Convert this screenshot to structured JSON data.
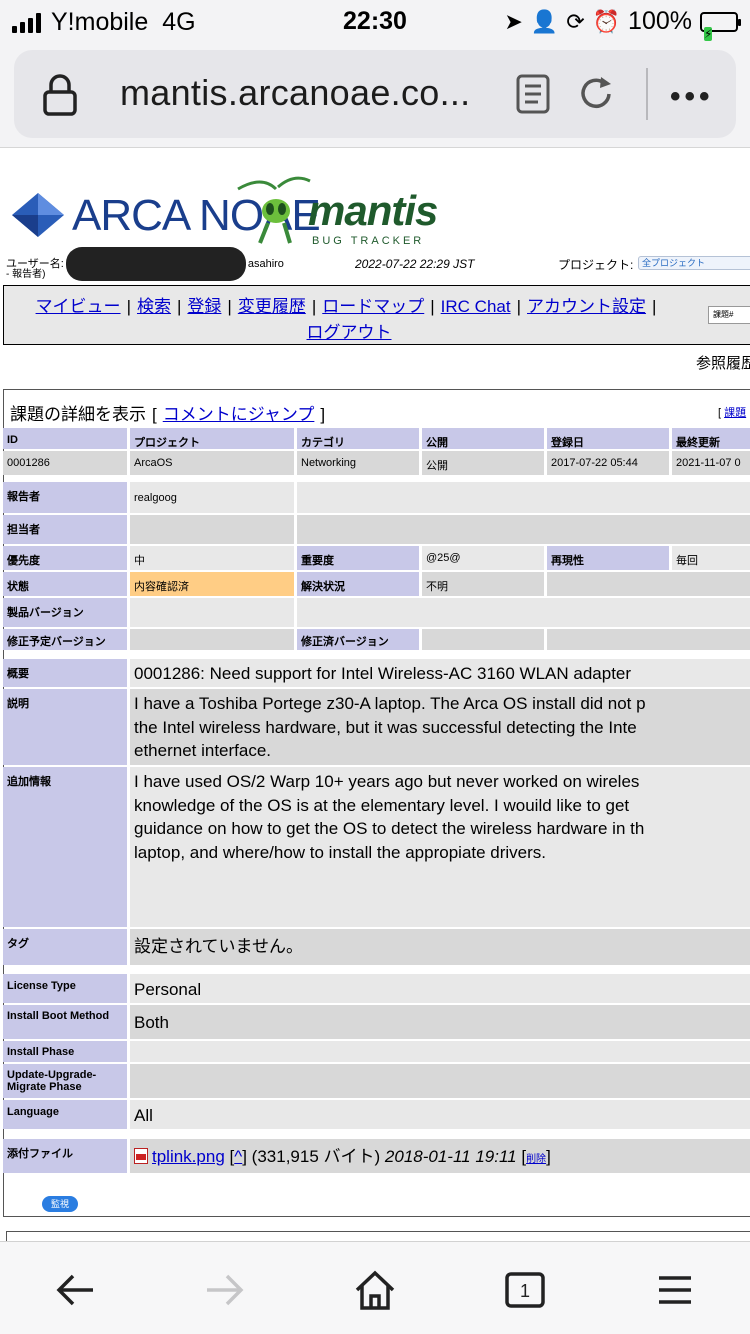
{
  "status": {
    "carrier": "Y!mobile",
    "network": "4G",
    "time": "22:30",
    "battery": "100%"
  },
  "browser": {
    "url": "mantis.arcanoae.co..."
  },
  "header": {
    "arca_logo_text": "ARCA NOAE",
    "mantis_logo_text": "mantis",
    "mantis_logo_sub": "BUG TRACKER",
    "username_label": "ユーザー名:",
    "username_suffix": "asahiro",
    "reporter_sub": "- 報告者)",
    "timestamp": "2022-07-22 22:29 JST",
    "project_label": "プロジェクト:",
    "project_value": "全プロジェクト"
  },
  "menu": {
    "items": [
      "マイビュー",
      "検索",
      "登録",
      "変更履歴",
      "ロードマップ",
      "IRC Chat",
      "アカウント設定"
    ],
    "logout": "ログアウト",
    "search_placeholder": "課題#"
  },
  "history_link": "参照履歴",
  "issue": {
    "title": "課題の詳細を表示",
    "jump_link": "コメントにジャンプ",
    "right_link": "課題",
    "columns": [
      "ID",
      "プロジェクト",
      "カテゴリ",
      "公開",
      "登録日",
      "最終更新"
    ],
    "values": [
      "0001286",
      "ArcaOS",
      "Networking",
      "公開",
      "2017-07-22 05:44",
      "2021-11-07 0"
    ],
    "reporter_label": "報告者",
    "reporter": "realgoog",
    "handler_label": "担当者",
    "priority_label": "優先度",
    "priority": "中",
    "severity_label": "重要度",
    "severity": "@25@",
    "reproducibility_label": "再現性",
    "reproducibility": "毎回",
    "status_label": "状態",
    "status": "内容確認済",
    "resolution_label": "解決状況",
    "resolution": "不明",
    "product_version_label": "製品バージョン",
    "target_version_label": "修正予定バージョン",
    "fixed_version_label": "修正済バージョン",
    "summary_label": "概要",
    "summary": "0001286: Need support for Intel Wireless-AC 3160 WLAN adapter",
    "description_label": "説明",
    "description": [
      "I have a Toshiba Portege z30-A laptop. The Arca OS install did not p",
      "the Intel wireless hardware, but it was successful detecting the Inte",
      "ethernet interface."
    ],
    "additional_label": "追加情報",
    "additional": [
      "I have used OS/2 Warp 10+ years ago but never worked on wireles",
      "knowledge of the OS is at the elementary level. I wouild like to get",
      "guidance on how to get the OS to detect the wireless hardware in th",
      "laptop, and where/how to install the appropiate drivers."
    ],
    "tags_label": "タグ",
    "tags": "設定されていません。",
    "license_label": "License Type",
    "license": "Personal",
    "boot_label": "Install Boot Method",
    "boot": "Both",
    "phase_label": "Install Phase",
    "upgrade_label": "Update-Upgrade-Migrate Phase",
    "language_label": "Language",
    "language": "All",
    "attach_label": "添付ファイル",
    "attach_file": "tplink.png",
    "attach_caret": "^",
    "attach_size": "(331,915 バイト)",
    "attach_date": "2018-01-11 19:11",
    "attach_delete": "削除",
    "monitor_button": "監視"
  }
}
